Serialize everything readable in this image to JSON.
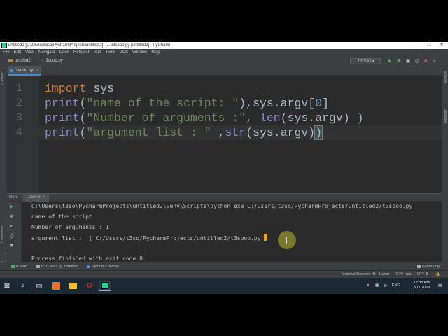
{
  "window": {
    "title": "untitled2 [C:\\Users\\t3so\\PycharmProjects\\untitled2] - ...\\t3sooo.py [untitled2] - PyCharm",
    "controls": [
      "—",
      "□",
      "✕"
    ]
  },
  "menu": [
    "File",
    "Edit",
    "View",
    "Navigate",
    "Code",
    "Refactor",
    "Run",
    "Tools",
    "VCS",
    "Window",
    "Help"
  ],
  "navbar": {
    "project": "untitled2",
    "file": "t3sooo.py",
    "run_config": "T3OOO"
  },
  "sidebar_left": [
    "1: Project",
    "2: Structure",
    "2: Favorites"
  ],
  "sidebar_right": [
    "SciView",
    "Database"
  ],
  "editor": {
    "tab": "t3sooo.py",
    "line_numbers": [
      "1",
      "2",
      "3",
      "4"
    ],
    "lines": [
      [
        {
          "t": "import",
          "c": "kw"
        },
        {
          "t": " sys",
          "c": ""
        }
      ],
      [
        {
          "t": "print",
          "c": "bi"
        },
        {
          "t": "(",
          "c": ""
        },
        {
          "t": "\"name of the script: \"",
          "c": "str"
        },
        {
          "t": "),sys.argv[",
          "c": ""
        },
        {
          "t": "0",
          "c": "num"
        },
        {
          "t": "]",
          "c": ""
        }
      ],
      [
        {
          "t": "print",
          "c": "bi"
        },
        {
          "t": "(",
          "c": ""
        },
        {
          "t": "\"Number of arguments :\"",
          "c": "str"
        },
        {
          "t": ", ",
          "c": ""
        },
        {
          "t": "len",
          "c": "bi"
        },
        {
          "t": "(sys.argv) )",
          "c": ""
        }
      ],
      [
        {
          "t": "print",
          "c": "bi"
        },
        {
          "t": "(",
          "c": ""
        },
        {
          "t": "\"argument list : \"",
          "c": "str"
        },
        {
          "t": " ,",
          "c": ""
        },
        {
          "t": "str",
          "c": "bi"
        },
        {
          "t": "(sys.argv)",
          "c": ""
        },
        {
          "t": ")",
          "c": "hl"
        }
      ]
    ]
  },
  "run_panel": {
    "label": "Run:",
    "tab": "t3sooo",
    "output": [
      "C:\\Users\\t3so\\PycharmProjects\\untitled2\\venv\\Scripts\\python.exe C:/Users/t3so/PycharmProjects/untitled2/t3sooo.py",
      "name of the script:",
      "Number of arguments : 1",
      "argument list :  ['C:/Users/t3so/PycharmProjects/untitled2/t3sooo.py'",
      "",
      "Process finished with exit code 0"
    ]
  },
  "tool_windows": [
    "4: Run",
    "6: TODO",
    "Terminal",
    "Python Console",
    "Event Log"
  ],
  "status": {
    "theme": "Material Oceanic",
    "chars": "1 char",
    "position": "4:70",
    "crlf": "n/a",
    "encoding": "UTF-8 ÷"
  },
  "taskbar": {
    "lang": "ENG",
    "time": "12:35 AM",
    "date": "2/17/2019"
  },
  "colors": {
    "editor_bg": "#2b2b2b",
    "keyword": "#cc7832",
    "builtin": "#8888c6",
    "string": "#6a8759",
    "number": "#6897bb"
  }
}
